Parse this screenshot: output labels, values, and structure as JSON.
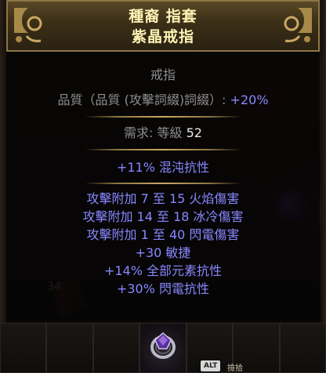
{
  "item": {
    "name": "種裔 指套",
    "base_type": "紫晶戒指",
    "item_class": "戒指",
    "quality_label": "品質（品質 (攻擊詞綴)詞綴）: ",
    "quality_value": "+20%",
    "requirement_label": "需求: 等級 ",
    "requirement_value": "52",
    "implicit": "+11% 混沌抗性",
    "explicit": [
      "攻擊附加 7 至 15 火焰傷害",
      "攻擊附加 14 至 18 冰冷傷害",
      "攻擊附加 1 至 40 閃電傷害",
      "+30 敏捷",
      "+14% 全部元素抗性",
      "+30% 閃電抗性"
    ]
  },
  "inventory": {
    "stack_count": "34",
    "alt_key": "ALT",
    "alt_hint": "撿拾"
  },
  "colors": {
    "header_text": "#fff3b5",
    "magic_text": "#8888ff",
    "label_text": "#8e8e8e",
    "value_text": "#e8e8e8"
  }
}
